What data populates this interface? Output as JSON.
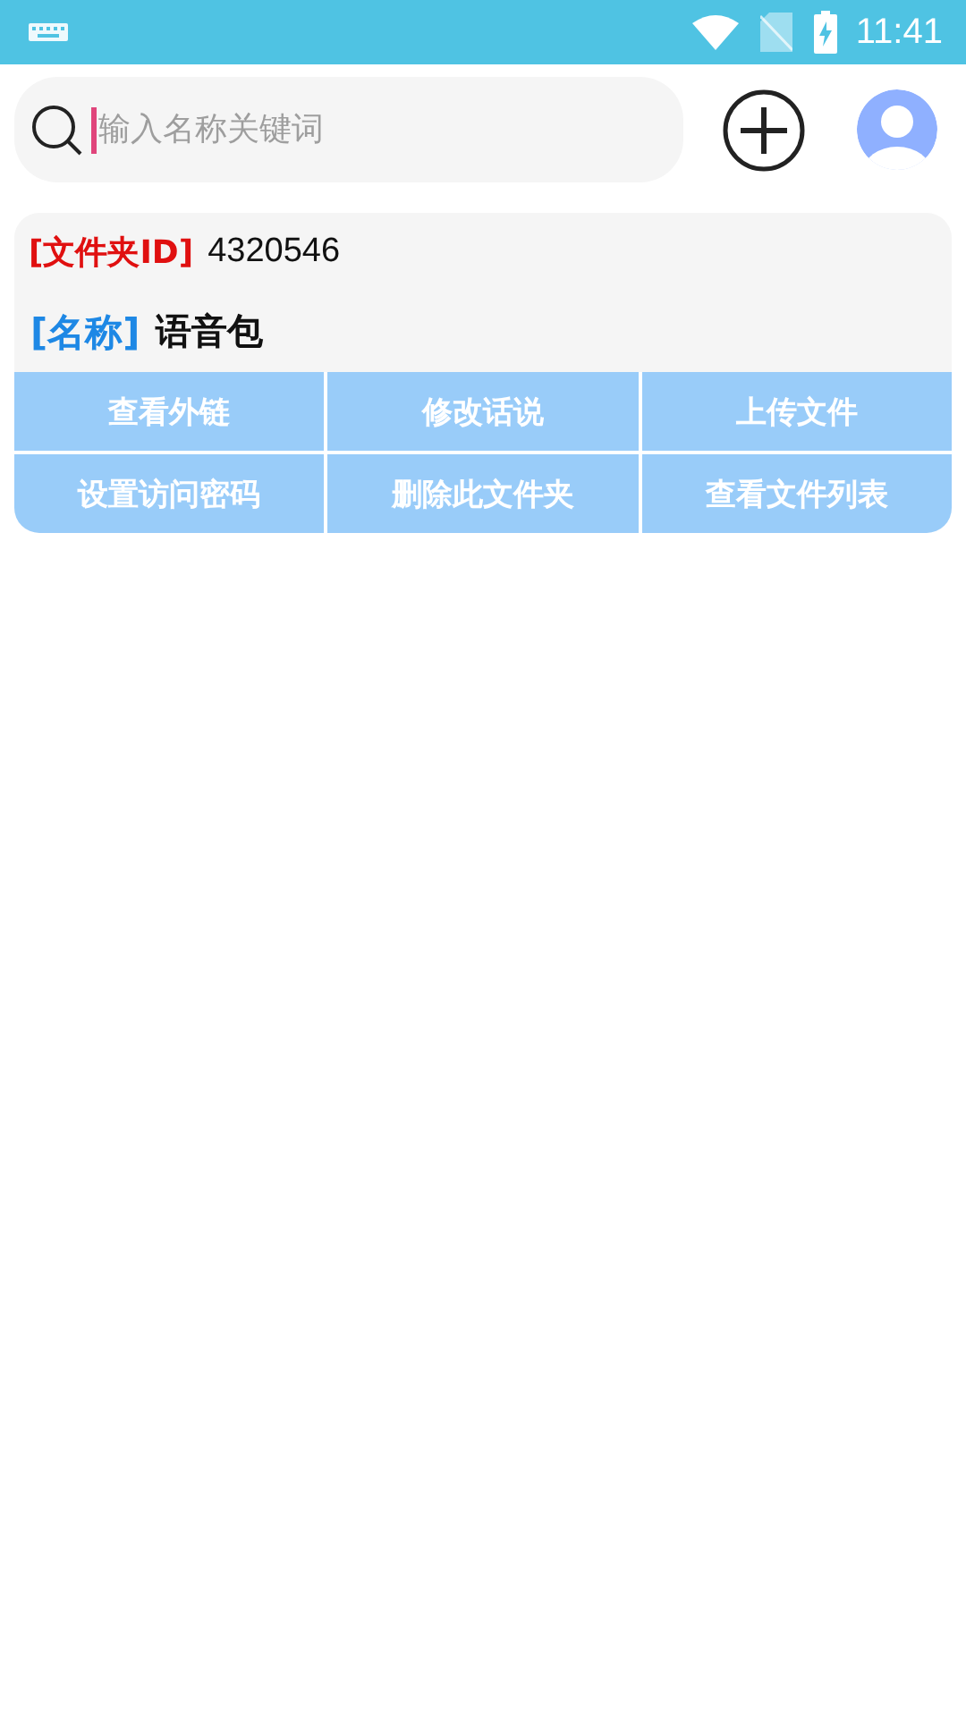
{
  "status_bar": {
    "time": "11:41"
  },
  "search": {
    "placeholder": "输入名称关键词"
  },
  "folder": {
    "id_label": "[文件夹ID]",
    "id": "4320546",
    "name_label": "[名称]",
    "name": "语音包",
    "actions": [
      "查看外链",
      "修改话说",
      "上传文件",
      "设置访问密码",
      "删除此文件夹",
      "查看文件列表"
    ]
  }
}
